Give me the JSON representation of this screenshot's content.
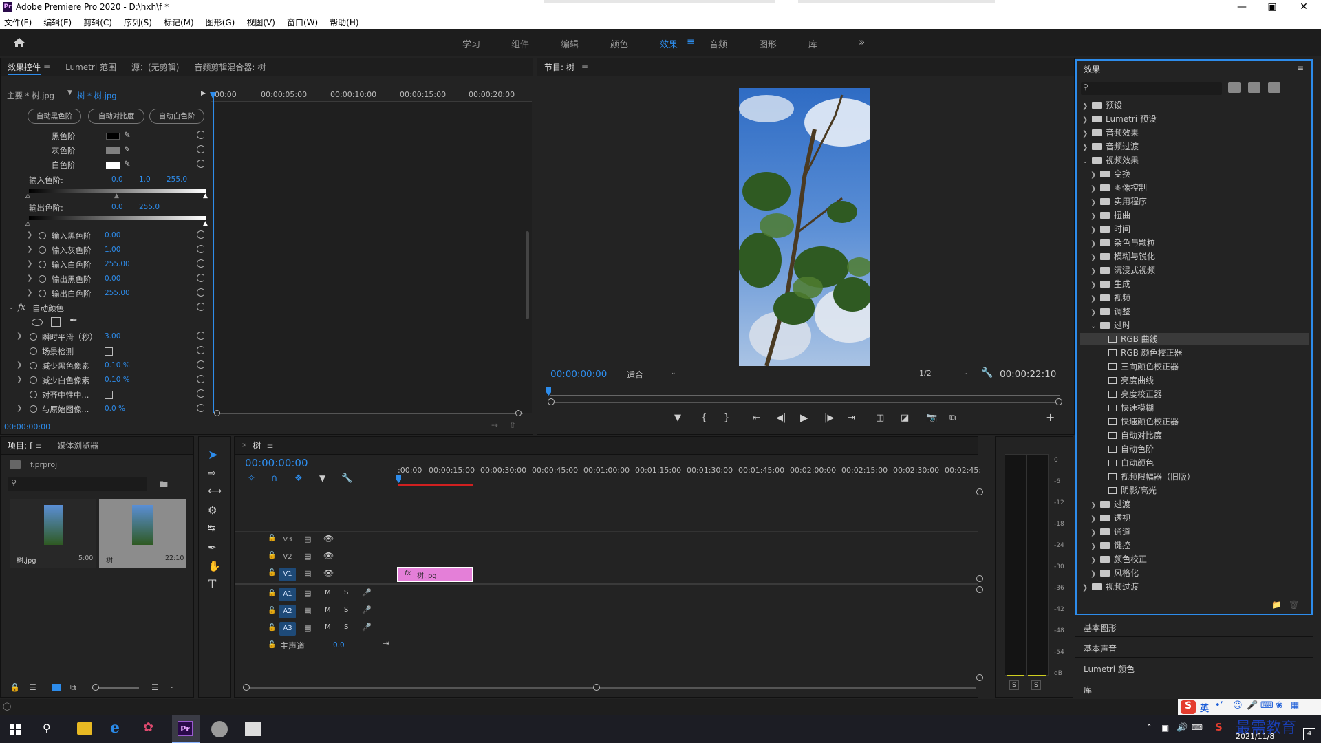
{
  "window": {
    "title": "Adobe Premiere Pro 2020 - D:\\hxh\\f *",
    "logo": "Pr"
  },
  "menu": [
    "文件(F)",
    "编辑(E)",
    "剪辑(C)",
    "序列(S)",
    "标记(M)",
    "图形(G)",
    "视图(V)",
    "窗口(W)",
    "帮助(H)"
  ],
  "workspaces": {
    "tabs": [
      "学习",
      "组件",
      "编辑",
      "颜色",
      "效果",
      "音频",
      "图形",
      "库"
    ],
    "active": "效果"
  },
  "effect_controls": {
    "tabs": [
      "效果控件",
      "Lumetri 范围",
      "源：(无剪辑)",
      "音频剪辑混合器: 树"
    ],
    "master": "主要 * 树.jpg",
    "clip": "树 * 树.jpg",
    "ruler": [
      "00:00",
      "00:00:05:00",
      "00:00:10:00",
      "00:00:15:00",
      "00:00:20:00"
    ],
    "buttons": [
      "自动黑色阶",
      "自动对比度",
      "自动白色阶"
    ],
    "levels": [
      {
        "label": "黑色阶",
        "color": "#000000"
      },
      {
        "label": "灰色阶",
        "color": "#808080"
      },
      {
        "label": "白色阶",
        "color": "#ffffff"
      }
    ],
    "input_levels": {
      "label": "输入色阶:",
      "v1": "0.0",
      "v2": "1.0",
      "v3": "255.0"
    },
    "output_levels": {
      "label": "输出色阶:",
      "v1": "0.0",
      "v2": "255.0"
    },
    "params": [
      {
        "label": "输入黑色阶",
        "value": "0.00"
      },
      {
        "label": "输入灰色阶",
        "value": "1.00"
      },
      {
        "label": "输入白色阶",
        "value": "255.00"
      },
      {
        "label": "输出黑色阶",
        "value": "0.00"
      },
      {
        "label": "输出白色阶",
        "value": "255.00"
      }
    ],
    "fx_name": "自动颜色",
    "auto_params": [
      {
        "label": "瞬时平滑（秒）",
        "value": "3.00"
      },
      {
        "label": "场景检测",
        "value": ""
      },
      {
        "label": "减少黑色像素",
        "value": "0.10 %"
      },
      {
        "label": "减少白色像素",
        "value": "0.10 %"
      },
      {
        "label": "对齐中性中...",
        "value": ""
      },
      {
        "label": "与原始图像...",
        "value": "0.0 %"
      }
    ],
    "timecode": "00:00:00:00"
  },
  "program": {
    "title": "节目: 树",
    "timecode": "00:00:00:00",
    "fit": "适合",
    "resolution": "1/2",
    "duration": "00:00:22:10"
  },
  "project": {
    "tabs": [
      "项目: f",
      "媒体浏览器"
    ],
    "file": "f.prproj",
    "items": [
      {
        "name": "树.jpg",
        "duration": "5:00"
      },
      {
        "name": "树",
        "duration": "22:10"
      }
    ]
  },
  "timeline": {
    "tab": "树",
    "timecode": "00:00:00:00",
    "ruler": [
      ":00:00",
      "00:00:15:00",
      "00:00:30:00",
      "00:00:45:00",
      "00:01:00:00",
      "00:01:15:00",
      "00:01:30:00",
      "00:01:45:00",
      "00:02:00:00",
      "00:02:15:00",
      "00:02:30:00",
      "00:02:45:"
    ],
    "video_tracks": [
      "V3",
      "V2",
      "V1"
    ],
    "audio_tracks": [
      "A1",
      "A2",
      "A3"
    ],
    "master": {
      "label": "主声道",
      "value": "0.0"
    },
    "clip": "树.jpg",
    "clip_color": "#e47fd8"
  },
  "meter": {
    "ticks": [
      "0",
      "-6",
      "-12",
      "-18",
      "-24",
      "-30",
      "-36",
      "-42",
      "-48",
      "-54",
      "dB"
    ],
    "solo": [
      "S",
      "S"
    ]
  },
  "effects": {
    "title": "效果",
    "tree": [
      {
        "label": "预设",
        "level": 0,
        "type": "folder",
        "open": false
      },
      {
        "label": "Lumetri 预设",
        "level": 0,
        "type": "folder",
        "open": false
      },
      {
        "label": "音频效果",
        "level": 0,
        "type": "folder",
        "open": false
      },
      {
        "label": "音频过渡",
        "level": 0,
        "type": "folder",
        "open": false
      },
      {
        "label": "视频效果",
        "level": 0,
        "type": "folder",
        "open": true
      },
      {
        "label": "变换",
        "level": 1,
        "type": "folder",
        "open": false
      },
      {
        "label": "图像控制",
        "level": 1,
        "type": "folder",
        "open": false
      },
      {
        "label": "实用程序",
        "level": 1,
        "type": "folder",
        "open": false
      },
      {
        "label": "扭曲",
        "level": 1,
        "type": "folder",
        "open": false
      },
      {
        "label": "时间",
        "level": 1,
        "type": "folder",
        "open": false
      },
      {
        "label": "杂色与颗粒",
        "level": 1,
        "type": "folder",
        "open": false
      },
      {
        "label": "模糊与锐化",
        "level": 1,
        "type": "folder",
        "open": false
      },
      {
        "label": "沉浸式视频",
        "level": 1,
        "type": "folder",
        "open": false
      },
      {
        "label": "生成",
        "level": 1,
        "type": "folder",
        "open": false
      },
      {
        "label": "视频",
        "level": 1,
        "type": "folder",
        "open": false
      },
      {
        "label": "调整",
        "level": 1,
        "type": "folder",
        "open": false
      },
      {
        "label": "过时",
        "level": 1,
        "type": "folder",
        "open": true
      },
      {
        "label": "RGB 曲线",
        "level": 2,
        "type": "fx",
        "selected": true
      },
      {
        "label": "RGB 颜色校正器",
        "level": 2,
        "type": "fx"
      },
      {
        "label": "三向颜色校正器",
        "level": 2,
        "type": "fx"
      },
      {
        "label": "亮度曲线",
        "level": 2,
        "type": "fx"
      },
      {
        "label": "亮度校正器",
        "level": 2,
        "type": "fx"
      },
      {
        "label": "快速模糊",
        "level": 2,
        "type": "fx"
      },
      {
        "label": "快速颜色校正器",
        "level": 2,
        "type": "fx"
      },
      {
        "label": "自动对比度",
        "level": 2,
        "type": "fx"
      },
      {
        "label": "自动色阶",
        "level": 2,
        "type": "fx"
      },
      {
        "label": "自动颜色",
        "level": 2,
        "type": "fx"
      },
      {
        "label": "视频限幅器（旧版）",
        "level": 2,
        "type": "fx"
      },
      {
        "label": "阴影/高光",
        "level": 2,
        "type": "fx"
      },
      {
        "label": "过渡",
        "level": 1,
        "type": "folder",
        "open": false
      },
      {
        "label": "透视",
        "level": 1,
        "type": "folder",
        "open": false
      },
      {
        "label": "通道",
        "level": 1,
        "type": "folder",
        "open": false
      },
      {
        "label": "键控",
        "level": 1,
        "type": "folder",
        "open": false
      },
      {
        "label": "颜色校正",
        "level": 1,
        "type": "folder",
        "open": false
      },
      {
        "label": "风格化",
        "level": 1,
        "type": "folder",
        "open": false
      },
      {
        "label": "视频过渡",
        "level": 0,
        "type": "folder",
        "open": false
      }
    ],
    "bottom_panels": [
      "基本图形",
      "基本声音",
      "Lumetri 颜色",
      "库"
    ]
  },
  "taskbar": {
    "ime": "英",
    "date": "2021/11/8",
    "watermark": "最需教育",
    "badge": "4"
  }
}
